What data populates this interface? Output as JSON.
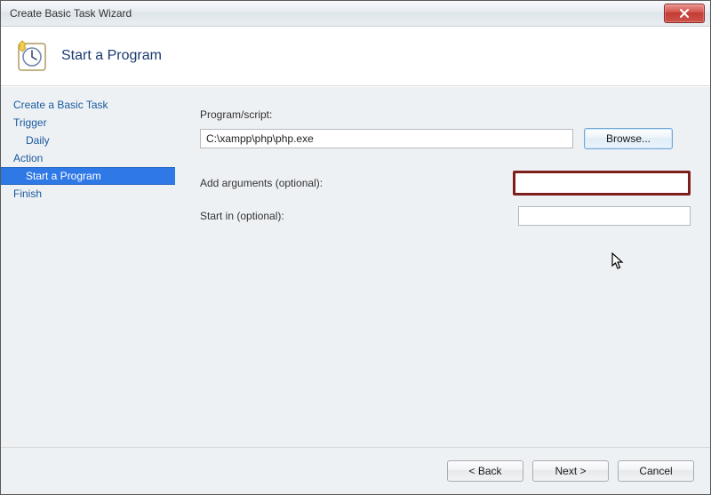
{
  "window": {
    "title": "Create Basic Task Wizard"
  },
  "header": {
    "title": "Start a Program"
  },
  "sidebar": {
    "items": [
      {
        "label": "Create a Basic Task",
        "selected": false,
        "indent": false
      },
      {
        "label": "Trigger",
        "selected": false,
        "indent": false
      },
      {
        "label": "Daily",
        "selected": false,
        "indent": true
      },
      {
        "label": "Action",
        "selected": false,
        "indent": false
      },
      {
        "label": "Start a Program",
        "selected": true,
        "indent": true
      },
      {
        "label": "Finish",
        "selected": false,
        "indent": false
      }
    ]
  },
  "form": {
    "program_label": "Program/script:",
    "program_value": "C:\\xampp\\php\\php.exe",
    "browse_label": "Browse...",
    "args_label": "Add arguments (optional):",
    "args_value": "",
    "startin_label": "Start in (optional):",
    "startin_value": ""
  },
  "buttons": {
    "back": "< Back",
    "next": "Next >",
    "cancel": "Cancel"
  }
}
